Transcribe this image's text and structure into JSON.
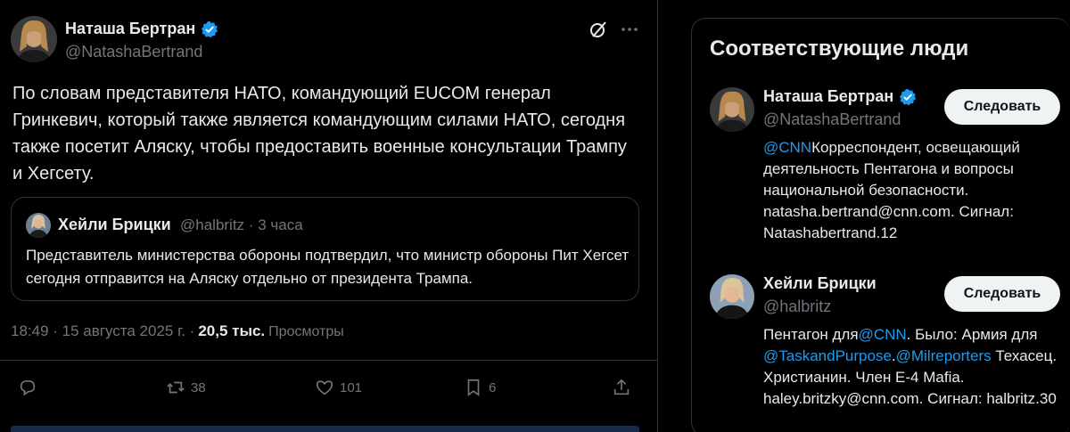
{
  "tweet": {
    "author_name": "Наташа Бертран",
    "author_handle": "@NatashaBertrand",
    "text": "По словам представителя НАТО, командующий EUCOM генерал Гринкевич, который также является командующим силами НАТО, сегодня также посетит Аляску, чтобы предоставить военные консультации Трампу и Хегсету.",
    "quote": {
      "author_name": "Хейли Брицки",
      "author_handle": "@halbritz",
      "separator": "·",
      "time": "3 часа",
      "text": "Представитель министерства обороны подтвердил, что министр обороны Пит Хегсет сегодня отправится на Аляску отдельно от президента Трампа."
    },
    "timestamp": "18:49 · 15 августа 2025 г. ·",
    "views_count": "20,5 тыс.",
    "views_label": "Просмотры",
    "actions": {
      "replies": "",
      "retweets": "38",
      "likes": "101",
      "bookmarks": "6"
    }
  },
  "sidebar": {
    "title": "Соответствующие люди",
    "people": [
      {
        "name": "Наташа Бертран",
        "handle": "@NatashaBertrand",
        "verified": true,
        "follow_label": "Следовать",
        "bio_link_1": "@CNN",
        "bio_text_1": "Корреспондент, освещающий деятельность Пентагона и вопросы национальной безопасности. natasha.bertrand@cnn.com. Сигнал: Natashabertrand.12"
      },
      {
        "name": "Хейли Брицки",
        "handle": "@halbritz",
        "verified": false,
        "follow_label": "Следовать",
        "bio_text_1": "Пентагон для",
        "bio_link_1": "@CNN",
        "bio_text_2": ". Было: Армия для",
        "bio_link_2": "@TaskandPurpose",
        "bio_text_3": ".",
        "bio_link_3": "@Milreporters",
        "bio_text_4": "Техасец. Христианин. Член E-4 Mafia. haley.britzky@cnn.com. Сигнал: halbritz.30"
      }
    ]
  },
  "colors": {
    "background": "#000000",
    "text": "#e7e9ea",
    "muted": "#71767b",
    "accent": "#1d9bf0",
    "border": "#2f3336"
  },
  "icons": [
    "verified-badge-icon",
    "grok-icon",
    "more-icon",
    "reply-icon",
    "retweet-icon",
    "like-icon",
    "bookmark-icon",
    "share-icon"
  ]
}
